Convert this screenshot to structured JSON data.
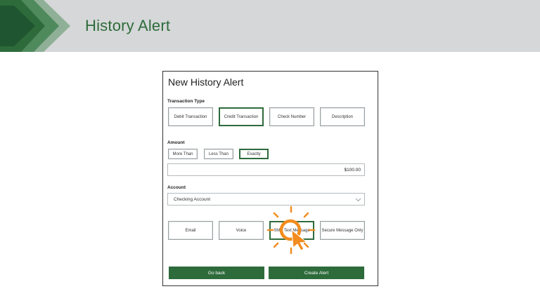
{
  "header": {
    "title": "History Alert"
  },
  "panel": {
    "title": "New History Alert",
    "transaction_type": {
      "label": "Transaction Type",
      "options": [
        "Debit Transaction",
        "Credit Transaction",
        "Check Number",
        "Description"
      ],
      "selected": "Credit Transaction"
    },
    "amount": {
      "label": "Amount",
      "options": [
        "More Than",
        "Less Than",
        "Exactly"
      ],
      "selected": "Exactly",
      "value": "$100.00"
    },
    "account": {
      "label": "Account",
      "value": "Checking Account"
    },
    "delivery": {
      "options": [
        "Email",
        "Voice",
        "SMS Text Message",
        "Secure Message Only"
      ],
      "selected": "SMS Text Message"
    },
    "go_back_label": "Go back",
    "create_label": "Create Alert"
  },
  "colors": {
    "brand_green": "#2e6b3b",
    "header_bg": "#d5d7d8",
    "tap_orange": "#f28c1e"
  },
  "icons": {
    "tap": "tap-indicator-icon",
    "chevron": "chevron-down-icon"
  }
}
